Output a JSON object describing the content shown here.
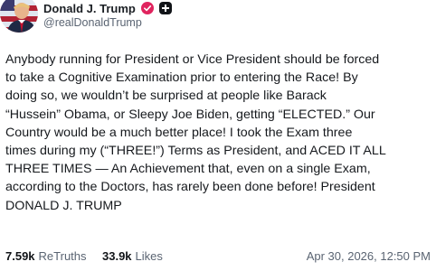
{
  "author": {
    "display_name": "Donald J. Trump",
    "handle": "@realDonaldTrump",
    "verified_icon": "verified-check-icon",
    "plus_badge_icon": "plus-badge-icon",
    "verified_color": "#e0245e"
  },
  "post": {
    "lines": [
      "Anybody running for President or Vice President should be forced",
      "to take a Cognitive Examination prior to entering the Race! By",
      "doing so, we wouldn’t be surprised at people like Barack",
      "“Hussein” Obama, or Sleepy Joe Biden, getting “ELECTED.” Our",
      "Country would be a much better place! I took the Exam three",
      "times during my (“THREE!”) Terms as President, and ACED IT ALL",
      "THREE TIMES — An Achievement that, even on a single Exam,",
      "according to the Doctors, has rarely been done before! President",
      "DONALD J. TRUMP"
    ]
  },
  "stats": {
    "retruths_count": "7.59k",
    "retruths_label": "ReTruths",
    "likes_count": "33.9k",
    "likes_label": "Likes"
  },
  "timestamp": "Apr 30, 2026, 12:50 PM"
}
